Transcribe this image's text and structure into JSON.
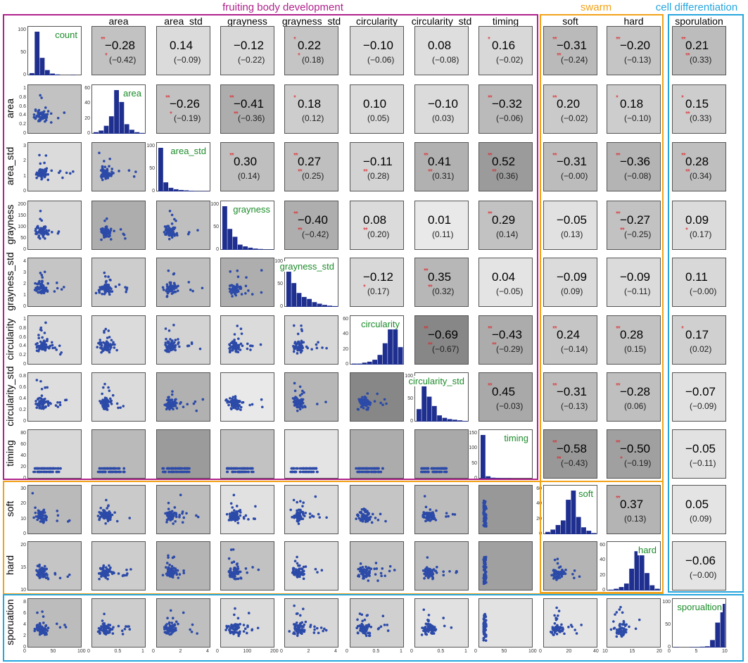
{
  "chart_data": {
    "type": "scatter",
    "variables": [
      "count",
      "area",
      "area_std",
      "grayness",
      "grayness_std",
      "circularity",
      "circularity_std",
      "timing",
      "soft",
      "hard",
      "sporulation"
    ],
    "column_labels": [
      "area",
      "area_std",
      "grayness",
      "grayness_std",
      "circularity",
      "circularity_std",
      "timing",
      "soft",
      "hard",
      "sporulation"
    ],
    "row_labels": [
      "area",
      "area_std",
      "grayness",
      "grayness_std",
      "circularity",
      "circularity_std",
      "timing",
      "soft",
      "hard",
      "sporuation"
    ],
    "diagonal_labels": [
      "count",
      "area",
      "area_std",
      "grayness",
      "grayness_std",
      "circularity",
      "circularity_std",
      "timing",
      "soft",
      "hard",
      "sporualtion"
    ],
    "groups": [
      {
        "name": "fruiting body development",
        "color": "#b0228c"
      },
      {
        "name": "swarm",
        "color": "#f2a218"
      },
      {
        "name": "cell differentiation",
        "color": "#26a6dd"
      }
    ],
    "correlations": {
      "0": {
        "1": [
          "−0.28",
          "(−0.42)",
          "**",
          "*"
        ],
        "2": [
          "0.14",
          "(−0.09)",
          "",
          ""
        ],
        "3": [
          "−0.12",
          "(−0.22)",
          "",
          ""
        ],
        "4": [
          "0.22",
          "(0.18)",
          "*",
          "*"
        ],
        "5": [
          "−0.10",
          "(−0.06)",
          "",
          ""
        ],
        "6": [
          "0.08",
          "(−0.08)",
          "",
          ""
        ],
        "7": [
          "0.16",
          "(−0.02)",
          "*",
          ""
        ],
        "8": [
          "−0.31",
          "(−0.24)",
          "**",
          "**"
        ],
        "9": [
          "−0.20",
          "(−0.13)",
          "**",
          ""
        ],
        "10": [
          "0.21",
          "(0.33)",
          "**",
          "**"
        ]
      },
      "1": {
        "2": [
          "−0.26",
          "(−0.19)",
          "**",
          "*"
        ],
        "3": [
          "−0.41",
          "(−0.36)",
          "**",
          "**"
        ],
        "4": [
          "0.18",
          "(0.12)",
          "*",
          ""
        ],
        "5": [
          "0.10",
          "(0.05)",
          "",
          ""
        ],
        "6": [
          "−0.10",
          "(0.03)",
          "",
          ""
        ],
        "7": [
          "−0.32",
          "(−0.06)",
          "**",
          ""
        ],
        "8": [
          "0.20",
          "(−0.02)",
          "**",
          ""
        ],
        "9": [
          "0.18",
          "(−0.10)",
          "*",
          ""
        ],
        "10": [
          "0.15",
          "(0.33)",
          "*",
          "**"
        ]
      },
      "2": {
        "3": [
          "0.30",
          "(0.14)",
          "**",
          ""
        ],
        "4": [
          "0.27",
          "(0.25)",
          "**",
          "**"
        ],
        "5": [
          "−0.11",
          "(0.28)",
          "",
          "**"
        ],
        "6": [
          "0.41",
          "(0.31)",
          "**",
          "**"
        ],
        "7": [
          "0.52",
          "(0.36)",
          "**",
          "**"
        ],
        "8": [
          "−0.31",
          "(−0.00)",
          "**",
          ""
        ],
        "9": [
          "−0.36",
          "(−0.08)",
          "**",
          ""
        ],
        "10": [
          "0.28",
          "(0.34)",
          "**",
          "**"
        ]
      },
      "3": {
        "4": [
          "−0.40",
          "(−0.42)",
          "**",
          "**"
        ],
        "5": [
          "0.08",
          "(0.20)",
          "",
          "**"
        ],
        "6": [
          "0.01",
          "(0.11)",
          "",
          ""
        ],
        "7": [
          "0.29",
          "(0.14)",
          "**",
          ""
        ],
        "8": [
          "−0.05",
          "(0.13)",
          "",
          ""
        ],
        "9": [
          "−0.27",
          "(−0.25)",
          "**",
          "**"
        ],
        "10": [
          "0.09",
          "(0.17)",
          "",
          "*"
        ]
      },
      "4": {
        "5": [
          "−0.12",
          "(0.17)",
          "",
          "*"
        ],
        "6": [
          "0.35",
          "(0.32)",
          "**",
          "**"
        ],
        "7": [
          "0.04",
          "(−0.05)",
          "",
          ""
        ],
        "8": [
          "−0.09",
          "(0.09)",
          "",
          ""
        ],
        "9": [
          "−0.09",
          "(−0.11)",
          "",
          ""
        ],
        "10": [
          "0.11",
          "(−0.00)",
          "",
          ""
        ]
      },
      "5": {
        "6": [
          "−0.69",
          "(−0.67)",
          "**",
          "**"
        ],
        "7": [
          "−0.43",
          "(−0.29)",
          "**",
          "**"
        ],
        "8": [
          "0.24",
          "(−0.14)",
          "**",
          ""
        ],
        "9": [
          "0.28",
          "(0.15)",
          "**",
          ""
        ],
        "10": [
          "0.17",
          "(0.02)",
          "*",
          ""
        ]
      },
      "6": {
        "7": [
          "0.45",
          "(−0.03)",
          "**",
          ""
        ],
        "8": [
          "−0.31",
          "(−0.13)",
          "**",
          ""
        ],
        "9": [
          "−0.28",
          "(0.06)",
          "**",
          ""
        ],
        "10": [
          "−0.07",
          "(−0.09)",
          "",
          ""
        ]
      },
      "7": {
        "8": [
          "−0.58",
          "(−0.43)",
          "**",
          "**"
        ],
        "9": [
          "−0.50",
          "(−0.19)",
          "**",
          "*"
        ],
        "10": [
          "−0.05",
          "(−0.11)",
          "",
          ""
        ]
      },
      "8": {
        "9": [
          "0.37",
          "(0.13)",
          "**",
          ""
        ],
        "10": [
          "0.05",
          "(0.09)",
          "",
          ""
        ]
      },
      "9": {
        "10": [
          "−0.06",
          "(−0.00)",
          "",
          ""
        ]
      }
    },
    "shading": {
      "0": {
        "1": 0.3,
        "2": 0.12,
        "3": 0.14,
        "4": 0.28,
        "5": 0.12,
        "6": 0.1,
        "7": 0.14,
        "8": 0.36,
        "9": 0.28,
        "10": 0.34
      },
      "1": {
        "2": 0.3,
        "3": 0.45,
        "4": 0.22,
        "5": 0.12,
        "6": 0.12,
        "7": 0.36,
        "8": 0.24,
        "9": 0.22,
        "10": 0.22
      },
      "2": {
        "3": 0.32,
        "4": 0.32,
        "5": 0.18,
        "6": 0.42,
        "7": 0.58,
        "8": 0.34,
        "9": 0.4,
        "10": 0.32
      },
      "3": {
        "4": 0.44,
        "5": 0.12,
        "6": 0.02,
        "7": 0.3,
        "8": 0.08,
        "9": 0.3,
        "10": 0.12
      },
      "4": {
        "5": 0.14,
        "6": 0.38,
        "7": 0.06,
        "8": 0.12,
        "9": 0.12,
        "10": 0.14
      },
      "5": {
        "6": 0.72,
        "7": 0.46,
        "8": 0.28,
        "9": 0.3,
        "10": 0.2
      },
      "6": {
        "7": 0.48,
        "8": 0.34,
        "9": 0.32,
        "10": 0.08
      },
      "7": {
        "8": 0.6,
        "9": 0.54,
        "10": 0.07
      },
      "8": {
        "9": 0.4,
        "10": 0.06
      },
      "9": {
        "10": 0.06
      }
    },
    "y_ticks": {
      "0": [
        "0",
        "50",
        "100"
      ],
      "1": [
        "0",
        "0.2",
        "0.4",
        "0.6",
        "0.8",
        "1"
      ],
      "2": [
        "0",
        "1",
        "2",
        "3"
      ],
      "3": [
        "0",
        "50",
        "100",
        "150",
        "200"
      ],
      "4": [
        "0",
        "1",
        "2",
        "3",
        "4"
      ],
      "5": [
        "0",
        "0.2",
        "0.4",
        "0.6",
        "0.8",
        "1"
      ],
      "6": [
        "0",
        "0.2",
        "0.4",
        "0.6",
        "0.8"
      ],
      "7": [
        "0",
        "20",
        "40",
        "60",
        "80"
      ],
      "8": [
        "0",
        "10",
        "20",
        "30"
      ],
      "9": [
        "10",
        "15",
        "20"
      ],
      "10": [
        "0",
        "2",
        "4",
        "6",
        "8"
      ]
    },
    "hist_y_ticks": {
      "0": [
        "0",
        "50",
        "100"
      ],
      "1": [
        "0",
        "20",
        "40",
        "60"
      ],
      "2": [
        "0",
        "50",
        "100"
      ],
      "3": [
        "0",
        "50",
        "100"
      ],
      "4": [
        "0",
        "50",
        "100"
      ],
      "5": [
        "0",
        "20",
        "40",
        "60"
      ],
      "6": [
        "0",
        "50",
        "100"
      ],
      "7": [
        "0",
        "50",
        "100",
        "150"
      ],
      "8": [
        "0",
        "20",
        "40",
        "60"
      ],
      "9": [
        "0",
        "20",
        "40",
        "60"
      ],
      "10": [
        "0",
        "50",
        "100"
      ]
    },
    "x_ticks": {
      "0": [
        "0",
        "50",
        "100"
      ],
      "1": [
        "0",
        "0.5",
        "1"
      ],
      "2": [
        "0",
        "2",
        "4"
      ],
      "3": [
        "0",
        "100",
        "200"
      ],
      "4": [
        "0",
        "2",
        "4"
      ],
      "5": [
        "0",
        "0.5",
        "1"
      ],
      "6": [
        "0",
        "0.5",
        "1"
      ],
      "7": [
        "0",
        "50",
        "100"
      ],
      "8": [
        "0",
        "20",
        "40"
      ],
      "9": [
        "10",
        "15",
        "20"
      ],
      "10": [
        "0",
        "5",
        "10"
      ]
    },
    "histograms": {
      "0": [
        5,
        100,
        40,
        12,
        4,
        2,
        0,
        0,
        1,
        0
      ],
      "1": [
        2,
        4,
        10,
        22,
        55,
        40,
        12,
        5,
        2,
        1
      ],
      "2": [
        120,
        25,
        10,
        6,
        4,
        3,
        2,
        1,
        1,
        1
      ],
      "3": [
        100,
        48,
        30,
        12,
        8,
        5,
        3,
        2,
        1,
        1
      ],
      "4": [
        110,
        60,
        35,
        25,
        20,
        12,
        8,
        5,
        3,
        2
      ],
      "5": [
        1,
        1,
        2,
        3,
        5,
        10,
        22,
        40,
        45,
        18
      ],
      "6": [
        20,
        70,
        40,
        25,
        10,
        6,
        4,
        3,
        2,
        1
      ],
      "7": [
        150,
        8,
        3,
        2,
        1,
        1,
        0,
        0,
        0,
        0
      ],
      "8": [
        2,
        4,
        8,
        12,
        30,
        38,
        15,
        6,
        3,
        1
      ],
      "9": [
        1,
        2,
        4,
        8,
        25,
        45,
        50,
        20,
        6,
        2
      ],
      "10": [
        1,
        0,
        0,
        1,
        1,
        2,
        3,
        18,
        60,
        105
      ]
    }
  }
}
